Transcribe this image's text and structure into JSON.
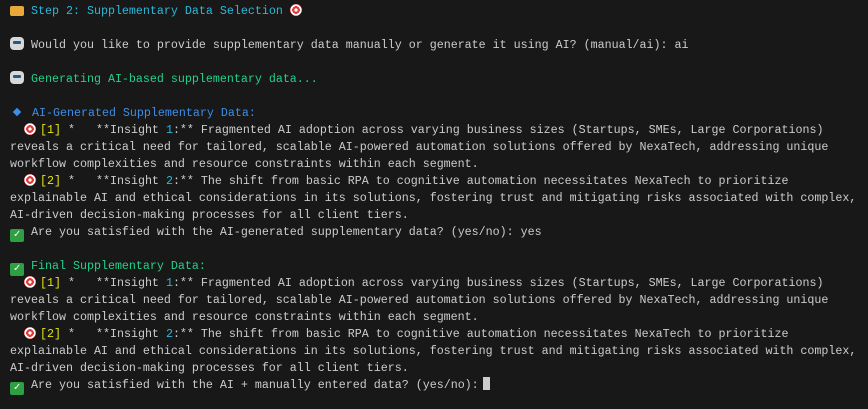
{
  "step_title": "Step 2: Supplementary Data Selection",
  "prompt_mode": "Would you like to provide supplementary data manually or generate it using AI? (manual/ai):",
  "answer_mode": "ai",
  "generating": "Generating AI-based supplementary data...",
  "ai_generated_header": "AI-Generated Supplementary Data:",
  "final_header": "Final Supplementary Data:",
  "insights": [
    {
      "tag_open": "[",
      "num": "1",
      "tag_close": "]",
      "prefix": " *   **Insight ",
      "n": "1",
      "suffix": ":** Fragmented AI adoption across varying business sizes (Startups, SMEs, Large Corporations)",
      "cont": [
        "reveals a critical need for tailored, scalable AI-powered automation solutions offered by NexaTech, addressing unique",
        "workflow complexities and resource constraints within each segment."
      ]
    },
    {
      "tag_open": "[",
      "num": "2",
      "tag_close": "]",
      "prefix": " *   **Insight ",
      "n": "2",
      "suffix": ":** The shift from basic RPA to cognitive automation necessitates NexaTech to prioritize",
      "cont": [
        "explainable AI and ethical considerations in its solutions, fostering trust and mitigating risks associated with complex,",
        "AI-driven decision-making processes for all client tiers."
      ]
    }
  ],
  "prompt_satisfied_ai": "Are you satisfied with the AI-generated supplementary data? (yes/no):",
  "answer_satisfied_ai": "yes",
  "prompt_satisfied_final": "Are you satisfied with the AI + manually entered data? (yes/no):",
  "icons": {
    "step": "folder-icon",
    "prompt": "robot-icon",
    "item": "target-icon",
    "ok": "check-icon"
  }
}
